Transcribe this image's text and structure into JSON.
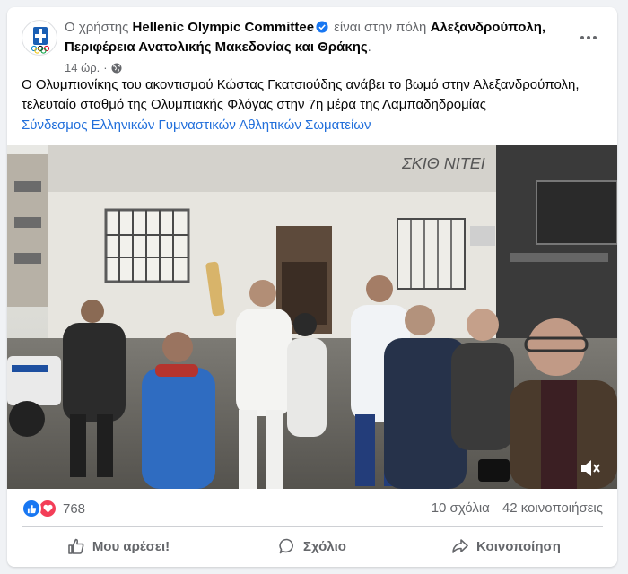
{
  "post": {
    "prefix": "Ο χρήστης",
    "author": "Hellenic Olympic Committee",
    "in_city": "είναι στην πόλη",
    "location": "Αλεξανδρούπολη, Περιφέρεια Ανατολικής Μακεδονίας και Θράκης",
    "period": ".",
    "time": "14 ώρ.",
    "separator": "·",
    "text": "Ο Ολυμπιονίκης του ακοντισμού Κώστας Γκατσιούδης ανάβει το βωμό στην Αλεξανδρούπολη, τελευταίο σταθμό της Ολυμπιακής Φλόγας στην 7η μέρα της Λαμπαδηδρομίας",
    "tag": "Σύνδεσμος Ελληνικών Γυμναστικών Αθλητικών Σωματείων"
  },
  "stats": {
    "reactions": "768",
    "comments": "10 σχόλια",
    "shares": "42 κοινοποιήσεις"
  },
  "actions": {
    "like": "Μου αρέσει!",
    "comment": "Σχόλιο",
    "share": "Κοινοποίηση"
  },
  "photo": {
    "wall_text": "ΣΚΙΘ ΝΙΤΕΙ"
  },
  "colors": {
    "link": "#216fdb",
    "like_blue": "#1877f2",
    "love_red": "#f33e58"
  }
}
